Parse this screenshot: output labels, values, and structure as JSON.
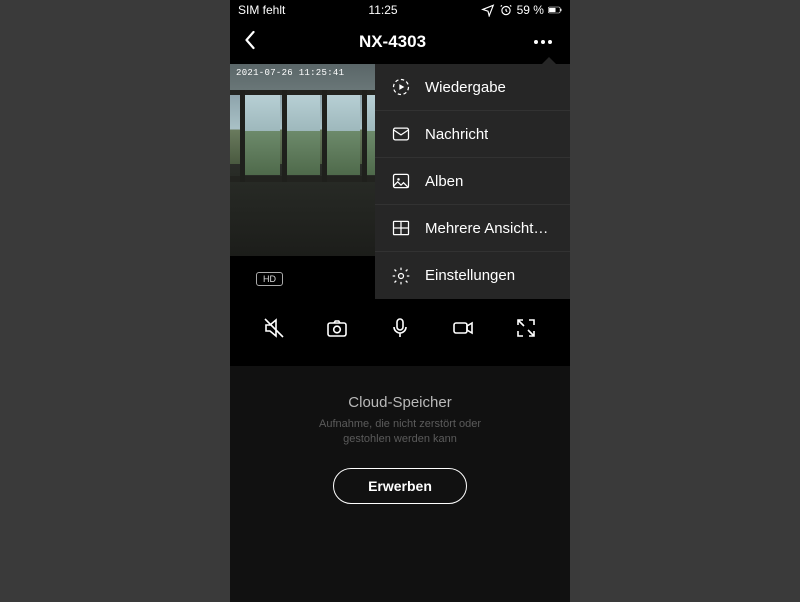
{
  "statusbar": {
    "sim": "SIM fehlt",
    "time": "11:25",
    "battery_pct": "59 %"
  },
  "header": {
    "title": "NX-4303"
  },
  "video": {
    "timestamp": "2021-07-26  11:25:41",
    "quality_badge": "HD"
  },
  "menu": {
    "items": [
      {
        "icon": "playback-icon",
        "label": "Wiedergabe"
      },
      {
        "icon": "message-icon",
        "label": "Nachricht"
      },
      {
        "icon": "album-icon",
        "label": "Alben"
      },
      {
        "icon": "grid-icon",
        "label": "Mehrere Ansicht…"
      },
      {
        "icon": "gear-icon",
        "label": "Einstellungen"
      }
    ]
  },
  "controls": {
    "mute": "mute",
    "photo": "snapshot",
    "mic": "talk",
    "record": "record",
    "expand": "fullscreen"
  },
  "cloud": {
    "title": "Cloud-Speicher",
    "subtitle": "Aufnahme, die nicht zerstört oder gestohlen werden kann",
    "cta": "Erwerben"
  }
}
